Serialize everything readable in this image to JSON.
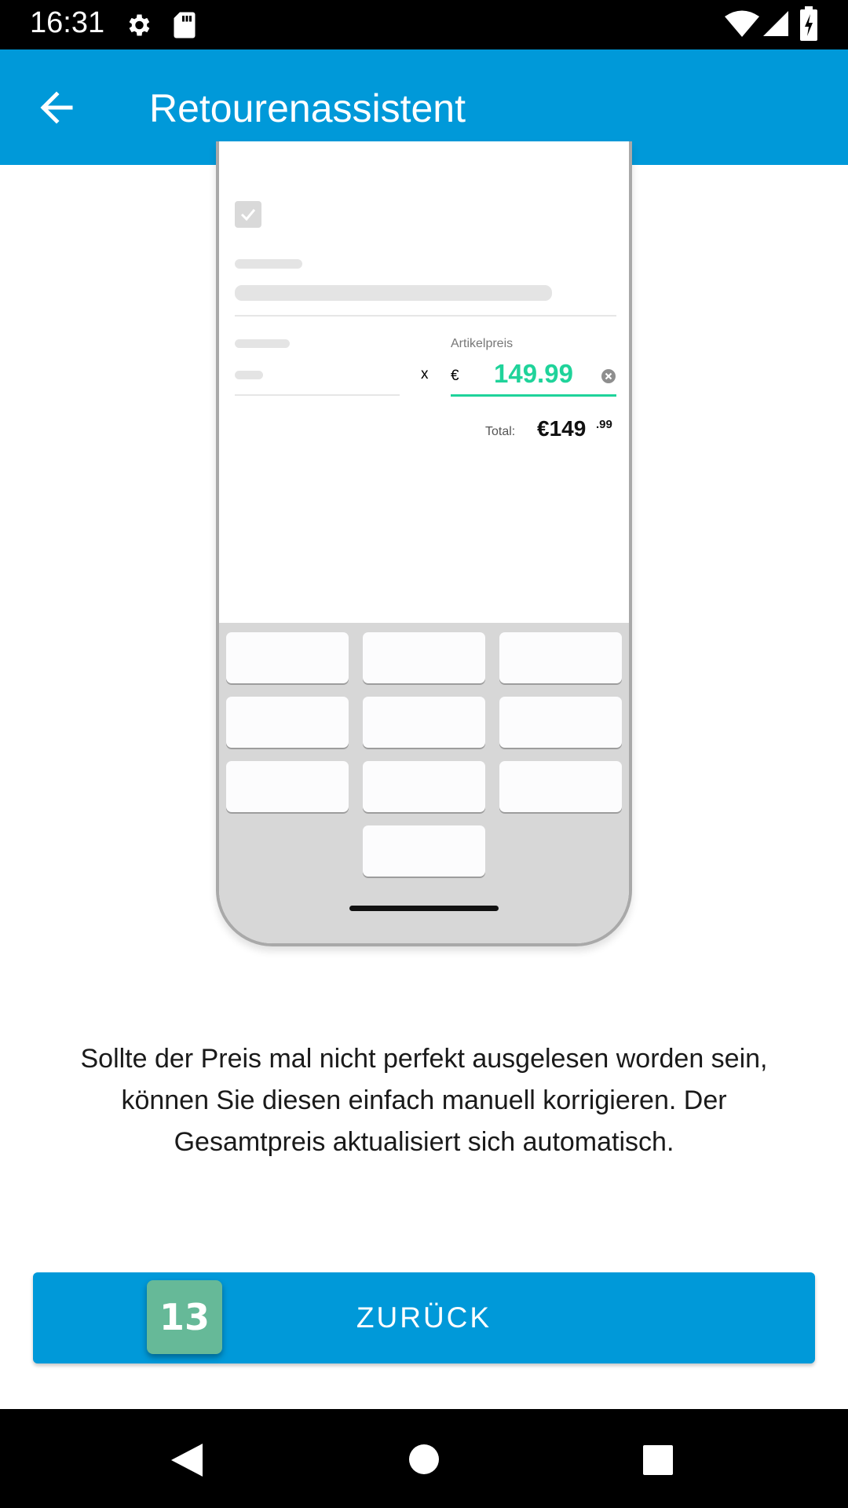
{
  "status_bar": {
    "time": "16:31",
    "left_icons": [
      "settings-icon",
      "sd-card-icon"
    ],
    "right_icons": [
      "wifi-icon",
      "signal-icon",
      "battery-icon"
    ]
  },
  "app_bar": {
    "title": "Retourenassistent",
    "back_icon": "arrow-left-icon"
  },
  "illustration": {
    "price_label": "Artikelpreis",
    "quantity_symbol": "x",
    "currency": "€",
    "price_value": "149.99",
    "total_label": "Total:",
    "total_main": "€149",
    "total_cents": ".99",
    "keypad_keys": 10
  },
  "description": "Sollte der Preis mal nicht perfekt ausgelesen worden sein, können Sie diesen einfach manuell korrigieren. Der Gesamtpreis aktualisiert sich automatisch.",
  "primary_button": {
    "label": "ZURÜCK"
  },
  "badge": {
    "value": "13"
  },
  "colors": {
    "primary": "#0099d9",
    "accent_price": "#1fd39a",
    "badge": "#66b998"
  }
}
